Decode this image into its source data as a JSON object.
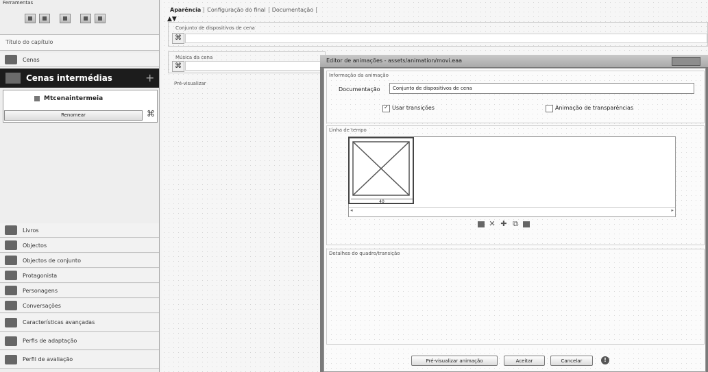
{
  "sidebar": {
    "tools_title": "Ferramentas",
    "chapter_title": "Título do capítulo",
    "scenes_label": "Cenas",
    "cutscenes_label": "Cenas intermédias",
    "cutscenes_add": "+",
    "cutscene_item": "Mtcenaintermeia",
    "rename_label": "Renomear",
    "bottom_items": [
      {
        "label": "Livros",
        "icon": "book-icon"
      },
      {
        "label": "Objectos",
        "icon": "objects-icon"
      },
      {
        "label": "Objectos de conjunto",
        "icon": "set-objects-icon"
      },
      {
        "label": "Protagonista",
        "icon": "player-icon"
      },
      {
        "label": "Personagens",
        "icon": "characters-icon"
      },
      {
        "label": "Conversações",
        "icon": "conversation-icon"
      },
      {
        "label": "Características avançadas",
        "icon": "advanced-icon"
      },
      {
        "label": "Perfis de adaptação",
        "icon": "adaptation-icon"
      },
      {
        "label": "Perfil de avaliação",
        "icon": "assessment-icon"
      }
    ]
  },
  "main": {
    "tabs": [
      "Aparência",
      "Configuração do final",
      "Documentação"
    ],
    "sort_arrows": "▲▼",
    "devset_title": "Conjunto de dispositivos de cena",
    "music_title": "Música da cena",
    "preview_label": "Pré-visualizar"
  },
  "dialog": {
    "title": "Editor de animações - assets/animation/movi.eaa",
    "info_title": "Informação da animação",
    "doc_label": "Documentação",
    "doc_value": "Conjunto de dispositivos de cena",
    "use_transitions": "Usar transições",
    "transparency": "Animação de transparências",
    "timeline_title": "Linha de tempo",
    "frame_duration": "40",
    "details_title": "Detalhes do quadro/transição",
    "preview_button": "Pré-visualizar animação",
    "accept_button": "Aceitar",
    "cancel_button": "Cancelar"
  }
}
